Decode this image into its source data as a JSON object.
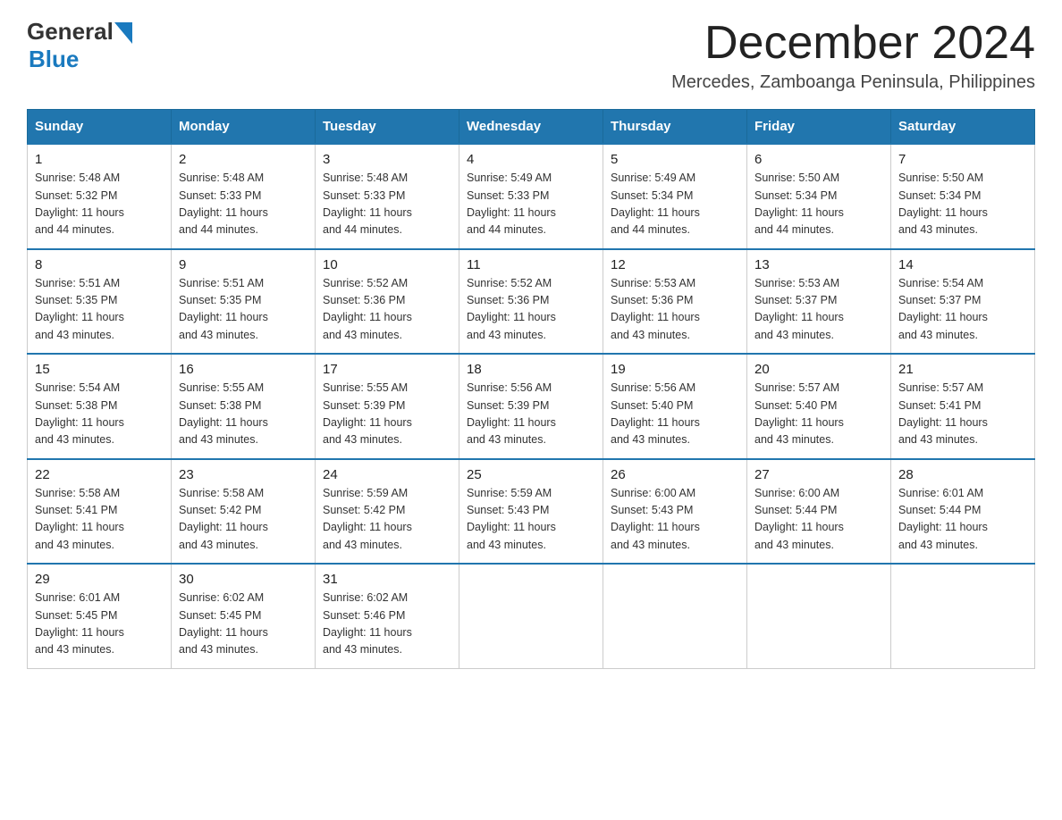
{
  "header": {
    "logo_general": "General",
    "logo_blue": "Blue",
    "month_title": "December 2024",
    "location": "Mercedes, Zamboanga Peninsula, Philippines"
  },
  "weekdays": [
    "Sunday",
    "Monday",
    "Tuesday",
    "Wednesday",
    "Thursday",
    "Friday",
    "Saturday"
  ],
  "weeks": [
    [
      {
        "day": "1",
        "sunrise": "5:48 AM",
        "sunset": "5:32 PM",
        "daylight": "11 hours and 44 minutes."
      },
      {
        "day": "2",
        "sunrise": "5:48 AM",
        "sunset": "5:33 PM",
        "daylight": "11 hours and 44 minutes."
      },
      {
        "day": "3",
        "sunrise": "5:48 AM",
        "sunset": "5:33 PM",
        "daylight": "11 hours and 44 minutes."
      },
      {
        "day": "4",
        "sunrise": "5:49 AM",
        "sunset": "5:33 PM",
        "daylight": "11 hours and 44 minutes."
      },
      {
        "day": "5",
        "sunrise": "5:49 AM",
        "sunset": "5:34 PM",
        "daylight": "11 hours and 44 minutes."
      },
      {
        "day": "6",
        "sunrise": "5:50 AM",
        "sunset": "5:34 PM",
        "daylight": "11 hours and 44 minutes."
      },
      {
        "day": "7",
        "sunrise": "5:50 AM",
        "sunset": "5:34 PM",
        "daylight": "11 hours and 43 minutes."
      }
    ],
    [
      {
        "day": "8",
        "sunrise": "5:51 AM",
        "sunset": "5:35 PM",
        "daylight": "11 hours and 43 minutes."
      },
      {
        "day": "9",
        "sunrise": "5:51 AM",
        "sunset": "5:35 PM",
        "daylight": "11 hours and 43 minutes."
      },
      {
        "day": "10",
        "sunrise": "5:52 AM",
        "sunset": "5:36 PM",
        "daylight": "11 hours and 43 minutes."
      },
      {
        "day": "11",
        "sunrise": "5:52 AM",
        "sunset": "5:36 PM",
        "daylight": "11 hours and 43 minutes."
      },
      {
        "day": "12",
        "sunrise": "5:53 AM",
        "sunset": "5:36 PM",
        "daylight": "11 hours and 43 minutes."
      },
      {
        "day": "13",
        "sunrise": "5:53 AM",
        "sunset": "5:37 PM",
        "daylight": "11 hours and 43 minutes."
      },
      {
        "day": "14",
        "sunrise": "5:54 AM",
        "sunset": "5:37 PM",
        "daylight": "11 hours and 43 minutes."
      }
    ],
    [
      {
        "day": "15",
        "sunrise": "5:54 AM",
        "sunset": "5:38 PM",
        "daylight": "11 hours and 43 minutes."
      },
      {
        "day": "16",
        "sunrise": "5:55 AM",
        "sunset": "5:38 PM",
        "daylight": "11 hours and 43 minutes."
      },
      {
        "day": "17",
        "sunrise": "5:55 AM",
        "sunset": "5:39 PM",
        "daylight": "11 hours and 43 minutes."
      },
      {
        "day": "18",
        "sunrise": "5:56 AM",
        "sunset": "5:39 PM",
        "daylight": "11 hours and 43 minutes."
      },
      {
        "day": "19",
        "sunrise": "5:56 AM",
        "sunset": "5:40 PM",
        "daylight": "11 hours and 43 minutes."
      },
      {
        "day": "20",
        "sunrise": "5:57 AM",
        "sunset": "5:40 PM",
        "daylight": "11 hours and 43 minutes."
      },
      {
        "day": "21",
        "sunrise": "5:57 AM",
        "sunset": "5:41 PM",
        "daylight": "11 hours and 43 minutes."
      }
    ],
    [
      {
        "day": "22",
        "sunrise": "5:58 AM",
        "sunset": "5:41 PM",
        "daylight": "11 hours and 43 minutes."
      },
      {
        "day": "23",
        "sunrise": "5:58 AM",
        "sunset": "5:42 PM",
        "daylight": "11 hours and 43 minutes."
      },
      {
        "day": "24",
        "sunrise": "5:59 AM",
        "sunset": "5:42 PM",
        "daylight": "11 hours and 43 minutes."
      },
      {
        "day": "25",
        "sunrise": "5:59 AM",
        "sunset": "5:43 PM",
        "daylight": "11 hours and 43 minutes."
      },
      {
        "day": "26",
        "sunrise": "6:00 AM",
        "sunset": "5:43 PM",
        "daylight": "11 hours and 43 minutes."
      },
      {
        "day": "27",
        "sunrise": "6:00 AM",
        "sunset": "5:44 PM",
        "daylight": "11 hours and 43 minutes."
      },
      {
        "day": "28",
        "sunrise": "6:01 AM",
        "sunset": "5:44 PM",
        "daylight": "11 hours and 43 minutes."
      }
    ],
    [
      {
        "day": "29",
        "sunrise": "6:01 AM",
        "sunset": "5:45 PM",
        "daylight": "11 hours and 43 minutes."
      },
      {
        "day": "30",
        "sunrise": "6:02 AM",
        "sunset": "5:45 PM",
        "daylight": "11 hours and 43 minutes."
      },
      {
        "day": "31",
        "sunrise": "6:02 AM",
        "sunset": "5:46 PM",
        "daylight": "11 hours and 43 minutes."
      },
      null,
      null,
      null,
      null
    ]
  ],
  "labels": {
    "sunrise": "Sunrise:",
    "sunset": "Sunset:",
    "daylight": "Daylight:"
  }
}
